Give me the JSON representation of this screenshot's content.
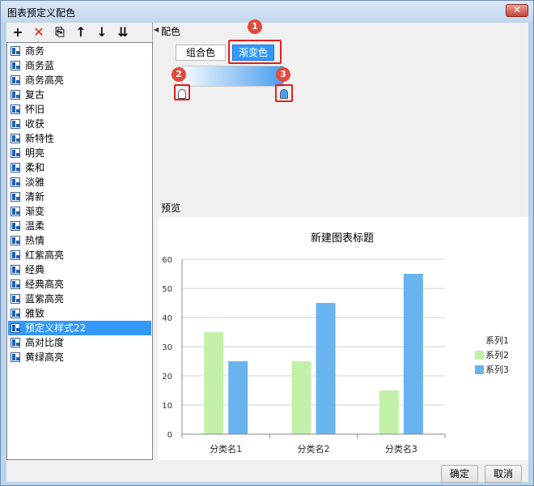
{
  "window": {
    "title": "图表预定义配色",
    "close_symbol": "✕"
  },
  "toolbar": {
    "add": "+",
    "delete": "✕",
    "copy": "⎘",
    "move_up": "↑",
    "move_down": "↓",
    "sort": "⇊"
  },
  "list": {
    "items": [
      "商务",
      "商务蓝",
      "商务高亮",
      "复古",
      "怀旧",
      "收获",
      "新特性",
      "明亮",
      "柔和",
      "淡雅",
      "清新",
      "渐变",
      "温柔",
      "热情",
      "红紫高亮",
      "经典",
      "经典高亮",
      "蓝紫高亮",
      "雅致",
      "预定义样式22",
      "高对比度",
      "黄绿高亮"
    ],
    "selected_index": 19
  },
  "config": {
    "section_label": "配色",
    "tab_combo": "组合色",
    "tab_gradient": "渐变色",
    "gradient_start_color": "#f5f9fd",
    "gradient_end_color": "#4a9ef0"
  },
  "callouts": [
    "1",
    "2",
    "3"
  ],
  "preview": {
    "section_label": "预览"
  },
  "chart_data": {
    "type": "bar",
    "title": "新建图表标题",
    "categories": [
      "分类名1",
      "分类名2",
      "分类名3"
    ],
    "series": [
      {
        "name": "系列1",
        "values": [
          null,
          null,
          null
        ],
        "color": "#ffffff"
      },
      {
        "name": "系列2",
        "values": [
          35,
          25,
          15
        ],
        "color": "#c3f0a8"
      },
      {
        "name": "系列3",
        "values": [
          25,
          45,
          55
        ],
        "color": "#69b4ee"
      }
    ],
    "ylim": [
      0,
      60
    ],
    "yticks": [
      "0",
      "10",
      "20",
      "30",
      "40",
      "50",
      "60"
    ],
    "grid": true,
    "legend_position": "right"
  },
  "footer": {
    "ok": "确定",
    "cancel": "取消"
  }
}
